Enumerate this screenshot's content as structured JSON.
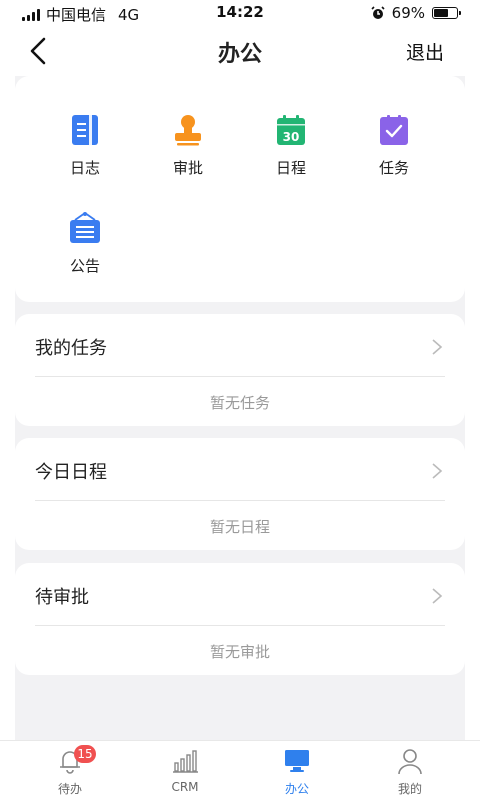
{
  "status_bar": {
    "carrier": "中国电信",
    "network": "4G",
    "time": "14:22",
    "battery": "69%",
    "battery_level": 0.69
  },
  "nav": {
    "title": "办公",
    "logout_label": "退出"
  },
  "apps": [
    {
      "label": "日志",
      "icon": "log-icon",
      "color": "#3a7cf0"
    },
    {
      "label": "审批",
      "icon": "approval-stamp-icon",
      "color": "#f7931e"
    },
    {
      "label": "日程",
      "icon": "calendar-icon",
      "color": "#22b573",
      "icon_text": "30"
    },
    {
      "label": "任务",
      "icon": "task-check-icon",
      "color": "#8a63e8"
    },
    {
      "label": "公告",
      "icon": "notice-board-icon",
      "color": "#3a7cf0"
    }
  ],
  "sections": [
    {
      "title": "我的任务",
      "empty": "暂无任务"
    },
    {
      "title": "今日日程",
      "empty": "暂无日程"
    },
    {
      "title": "待审批",
      "empty": "暂无审批"
    }
  ],
  "tabbar": {
    "active_color": "#2f80ed",
    "items": [
      {
        "label": "待办",
        "icon": "bell-icon",
        "badge": "15"
      },
      {
        "label": "CRM",
        "icon": "bar-chart-icon"
      },
      {
        "label": "办公",
        "icon": "monitor-icon"
      },
      {
        "label": "我的",
        "icon": "person-icon"
      }
    ]
  }
}
